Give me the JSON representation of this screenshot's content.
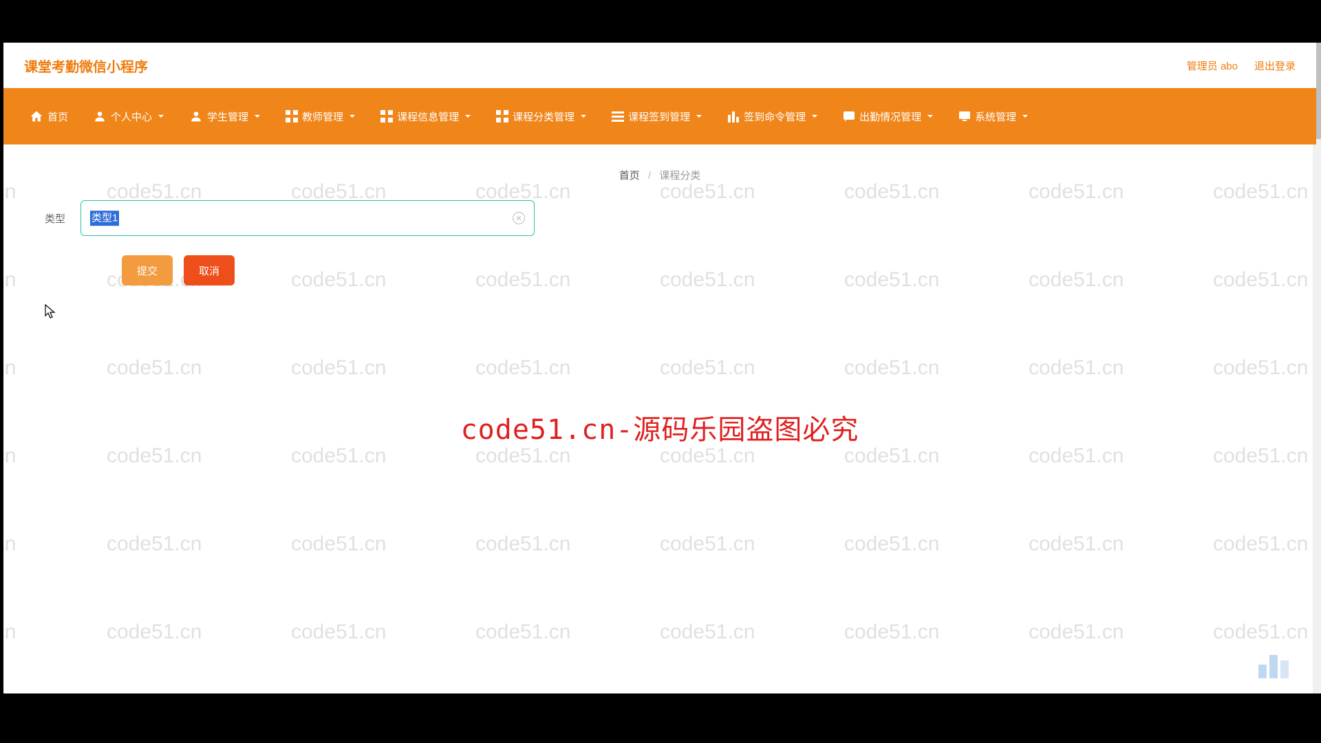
{
  "app": {
    "title": "课堂考勤微信小程序"
  },
  "user": {
    "label": "管理员 abo",
    "logout": "退出登录"
  },
  "nav": {
    "home": "首页",
    "personal": "个人中心",
    "student": "学生管理",
    "teacher": "教师管理",
    "course_info": "课程信息管理",
    "course_cat": "课程分类管理",
    "course_sign": "课程签到管理",
    "signin_cmd": "签到命令管理",
    "attendance": "出勤情况管理",
    "system": "系统管理"
  },
  "breadcrumb": {
    "home": "首页",
    "current": "课程分类"
  },
  "form": {
    "type_label": "类型",
    "type_value": "类型1",
    "submit": "提交",
    "cancel": "取消"
  },
  "watermark": {
    "text": "code51.cn",
    "center": "code51.cn-源码乐园盗图必究"
  }
}
